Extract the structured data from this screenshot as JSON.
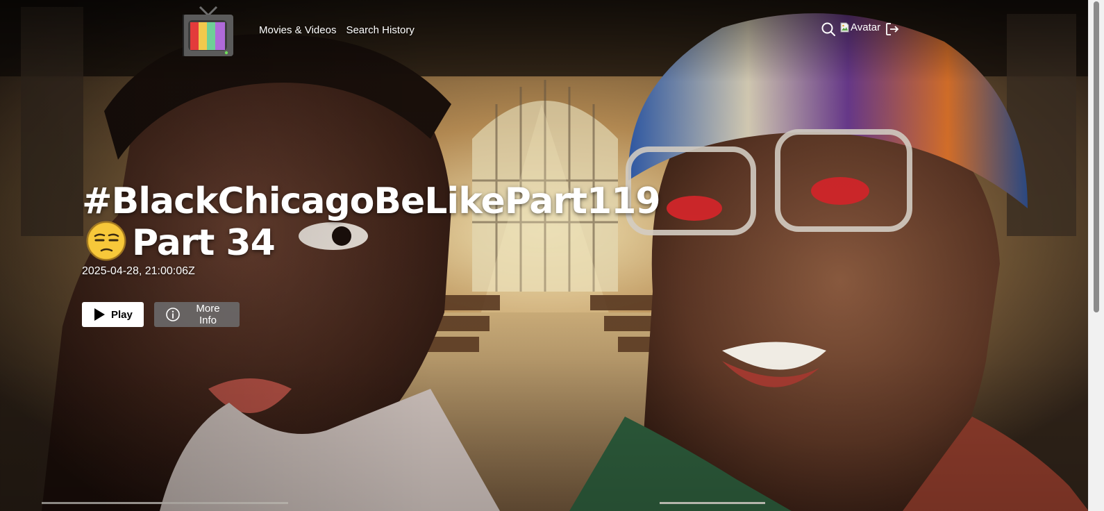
{
  "nav": {
    "logo_icon": "retro-tv-logo-icon",
    "links": [
      "Movies & Videos",
      "Search History"
    ],
    "search_icon": "search-icon",
    "avatar_alt": "Avatar",
    "logout_icon": "logout-icon"
  },
  "hero": {
    "title_line1": "#BlackChicagoBeLikePart119",
    "title_emoji": "unamused-face-emoji",
    "title_line2": "Part 34",
    "date": "2025-04-28, 21:00:06Z",
    "play_label": "Play",
    "play_icon": "play-icon",
    "info_label": "More Info",
    "info_icon": "info-circle-icon"
  },
  "colors": {
    "play_bg": "#ffffff",
    "info_bg": "#6d6d6e",
    "text": "#ffffff"
  }
}
